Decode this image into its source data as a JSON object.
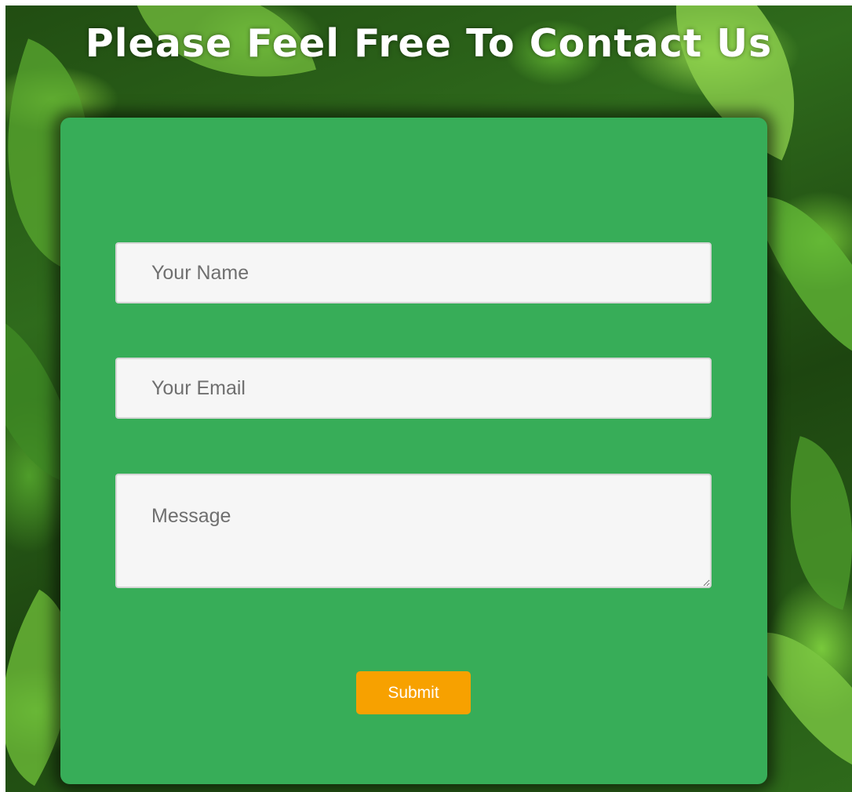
{
  "page": {
    "title": "Please Feel Free To Contact Us"
  },
  "form": {
    "name_placeholder": "Your Name",
    "name_value": "",
    "email_placeholder": "Your Email",
    "email_value": "",
    "message_placeholder": "Message",
    "message_value": "",
    "submit_label": "Submit"
  },
  "colors": {
    "card_background": "#37ad58",
    "field_background": "#f6f6f6",
    "submit_background": "#f7a100",
    "title_text": "#ffffff"
  },
  "background": {
    "description_icon": "green-leaves-background"
  }
}
